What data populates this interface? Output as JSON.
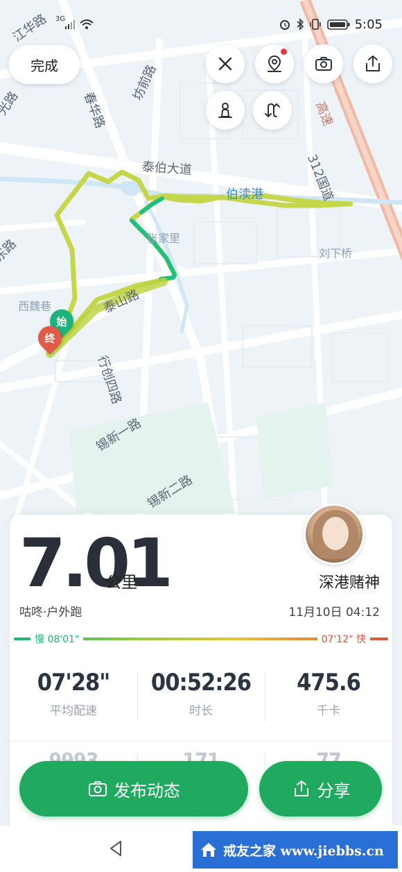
{
  "status_bar": {
    "time": "5:05",
    "network": "3G",
    "icons": [
      "signal-icon",
      "wifi-icon",
      "alarm-icon",
      "bluetooth-icon",
      "vibrate-icon",
      "battery-icon"
    ]
  },
  "map": {
    "labels": {
      "jianghua_road": "江华路",
      "chunhua_road": "春华路",
      "fangqian_road": "坊前路",
      "guang_road": "光路",
      "taibo_avenue": "泰伯大道",
      "bodu_port": "伯渎港",
      "hwy_312": "312国道",
      "expressway": "高速",
      "zhangjiali": "张家里",
      "liuxia_bridge": "刘下桥",
      "dong_road": "东路",
      "xiweixiang": "西魏巷",
      "taishan_road": "泰山路",
      "xingchuang4_road": "行创四路",
      "xixin1_road": "锡新一路",
      "xixin2_road": "锡新二路"
    },
    "start_marker": "始",
    "end_marker": "终",
    "colors": {
      "route_slow": "#1db37b",
      "route_fast": "#c8d84a",
      "water": "#cfe6f6",
      "road": "#ffffff",
      "highway": "#f2b7a3"
    }
  },
  "controls": {
    "done_label": "完成",
    "buttons": [
      "close-icon",
      "location-pin-icon",
      "camera-icon",
      "share-icon",
      "person-icon",
      "route-icon"
    ]
  },
  "record": {
    "distance": "7.01",
    "unit": "公里",
    "nickname": "深港赌神",
    "subtitle": "咕咚·户外跑",
    "date": "11月10日 04:12",
    "pace_slow_label": "慢 08'01\"",
    "pace_fast_label": "07'12\" 快",
    "stats": [
      {
        "value": "07'28\"",
        "label": "平均配速"
      },
      {
        "value": "00:52:26",
        "label": "时长"
      },
      {
        "value": "475.6",
        "label": "千卡"
      }
    ],
    "stats_row2": [
      {
        "value": "9993"
      },
      {
        "value": "171"
      },
      {
        "value": "77"
      }
    ]
  },
  "actions": {
    "publish_label": "发布动态",
    "share_label": "分享"
  },
  "watermark": {
    "text": "戒友之家 www.jiebbs.cn"
  }
}
